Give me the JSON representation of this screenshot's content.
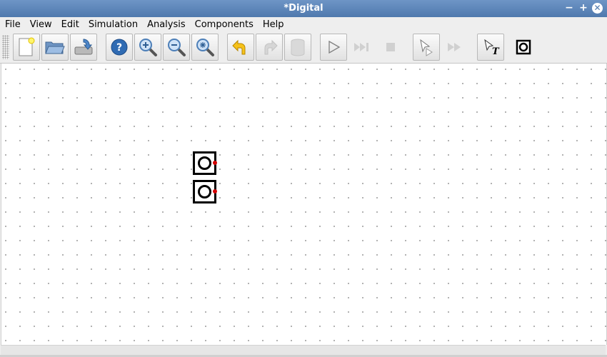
{
  "window": {
    "title": "*Digital"
  },
  "window_controls": {
    "minimize": "−",
    "maximize": "+",
    "close": "✕"
  },
  "menu": [
    "File",
    "View",
    "Edit",
    "Simulation",
    "Analysis",
    "Components",
    "Help"
  ],
  "toolbar": {
    "buttons": [
      {
        "name": "new-file",
        "icon": "new-file-icon",
        "enabled": true
      },
      {
        "name": "open-file",
        "icon": "open-folder-icon",
        "enabled": true
      },
      {
        "name": "save-file",
        "icon": "save-icon",
        "enabled": true
      },
      {
        "name": "help",
        "icon": "help-icon",
        "enabled": true
      },
      {
        "name": "zoom-in",
        "icon": "zoom-in-icon",
        "enabled": true
      },
      {
        "name": "zoom-out",
        "icon": "zoom-out-icon",
        "enabled": true
      },
      {
        "name": "zoom-fit",
        "icon": "zoom-fit-icon",
        "enabled": true
      },
      {
        "name": "undo",
        "icon": "undo-icon",
        "enabled": true
      },
      {
        "name": "redo",
        "icon": "redo-icon",
        "enabled": false
      },
      {
        "name": "delete",
        "icon": "trash-icon",
        "enabled": false
      },
      {
        "name": "start-simulation",
        "icon": "play-icon",
        "enabled": true
      },
      {
        "name": "fast-run",
        "icon": "fast-forward-icon",
        "enabled": false
      },
      {
        "name": "stop-simulation",
        "icon": "stop-icon",
        "enabled": false
      },
      {
        "name": "analyse",
        "icon": "analyse-icon",
        "enabled": true
      },
      {
        "name": "step",
        "icon": "step-icon",
        "enabled": false
      },
      {
        "name": "insert-text",
        "icon": "text-tool-icon",
        "enabled": true
      },
      {
        "name": "last-component",
        "icon": "component-icon",
        "enabled": true
      }
    ]
  },
  "canvas": {
    "components": [
      {
        "type": "input",
        "icon": "input-component-icon"
      },
      {
        "type": "input",
        "icon": "input-component-icon"
      }
    ]
  },
  "colors": {
    "titlebar": "#5b82b5",
    "pin": "#d40000",
    "grid_dot": "#a6a6a6"
  }
}
